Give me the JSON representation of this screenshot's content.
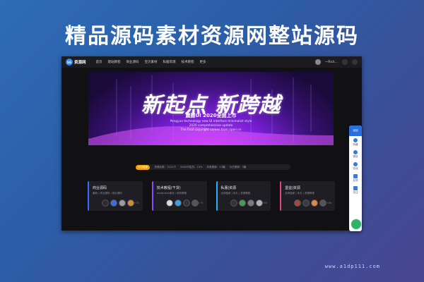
{
  "page": {
    "title": "精品源码素材资源网整站源码",
    "watermark": "www.a1dp111.com"
  },
  "site": {
    "logo_text": "资源网",
    "logo_mark": "SG",
    "nav": [
      "首页",
      "建站教程",
      "商业源码",
      "宝贝素材",
      "私服资源",
      "技术教程",
      "更多"
    ],
    "user_label": "一Rick..."
  },
  "hero": {
    "heading": "新起点 新跨越",
    "subtitle": "震撼UI 2020全面上市",
    "en_line1": "Pengyun technology new UI interface minimalist style",
    "en_line2": "2020 comprehensive update",
    "en_line3": "The final copyright comes from ripon.cn"
  },
  "stats": {
    "badge": "今日更新",
    "items": [
      "资源总数：2151个",
      "SSSVIP会员：10%",
      "本周更新：13篇",
      "今日更新：3篇"
    ]
  },
  "cards": [
    {
      "title": "商业源码",
      "desc": "最新 / 商业源码 / 商业源码",
      "count": "+35",
      "avatars": [
        "#2a2a33",
        "#3d6de0",
        "#9c9ca8",
        "#d08a3a"
      ]
    },
    {
      "title": "技术教程(干货)",
      "desc": "wordpress美化 / 网页教程",
      "count": "+75",
      "avatars": [
        "#ddd",
        "#3aa0e0",
        "#333",
        "#555"
      ]
    },
    {
      "title": "私服|资源",
      "desc": "全网独家 | 永久 | 资源教程",
      "count": "+55",
      "avatars": [
        "#333",
        "#4a9a5a",
        "#7a7a85",
        "#b0b0b8"
      ]
    },
    {
      "title": "堡垒|资源",
      "desc": "全网独家 | 永久 | 资源教程",
      "count": "+86",
      "avatars": [
        "#a04a3a",
        "#3a3a44",
        "#e08a4a",
        "#555"
      ]
    }
  ],
  "sidebar": {
    "top": "返回",
    "items": [
      "收藏",
      "微信",
      "在线",
      "反馈",
      "关注"
    ]
  }
}
